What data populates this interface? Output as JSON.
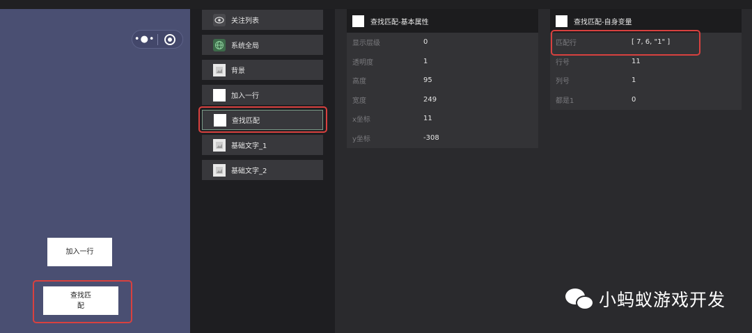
{
  "preview": {
    "buttons": {
      "add_row": "加入一行",
      "find_match_line1": "查找匹",
      "find_match_line2": "配"
    }
  },
  "node_list": [
    {
      "label": "关注列表",
      "icon": "eye-icon"
    },
    {
      "label": "系统全局",
      "icon": "globe-icon"
    },
    {
      "label": "背景",
      "icon": "image-icon"
    },
    {
      "label": "加入一行",
      "icon": "white-square-icon"
    },
    {
      "label": "查找匹配",
      "icon": "white-square-icon",
      "selected": true
    },
    {
      "label": "基础文字_1",
      "icon": "image-icon"
    },
    {
      "label": "基础文字_2",
      "icon": "image-icon"
    }
  ],
  "basic_panel": {
    "title": "查找匹配-基本属性",
    "rows": [
      {
        "key": "显示层级",
        "value": "0"
      },
      {
        "key": "透明度",
        "value": "1"
      },
      {
        "key": "高度",
        "value": "95"
      },
      {
        "key": "宽度",
        "value": "249"
      },
      {
        "key": "x坐标",
        "value": "11"
      },
      {
        "key": "y坐标",
        "value": "-308"
      }
    ]
  },
  "vars_panel": {
    "title": "查找匹配-自身变量",
    "rows": [
      {
        "key": "匹配行",
        "value": "[ 7, 6, \"1\" ]"
      },
      {
        "key": "行号",
        "value": "11"
      },
      {
        "key": "列号",
        "value": "1"
      },
      {
        "key": "都是1",
        "value": "0"
      }
    ]
  },
  "watermark": {
    "text": "小蚂蚁游戏开发"
  },
  "colors": {
    "highlight": "#d9413f",
    "preview_bg": "#4a4f72"
  }
}
